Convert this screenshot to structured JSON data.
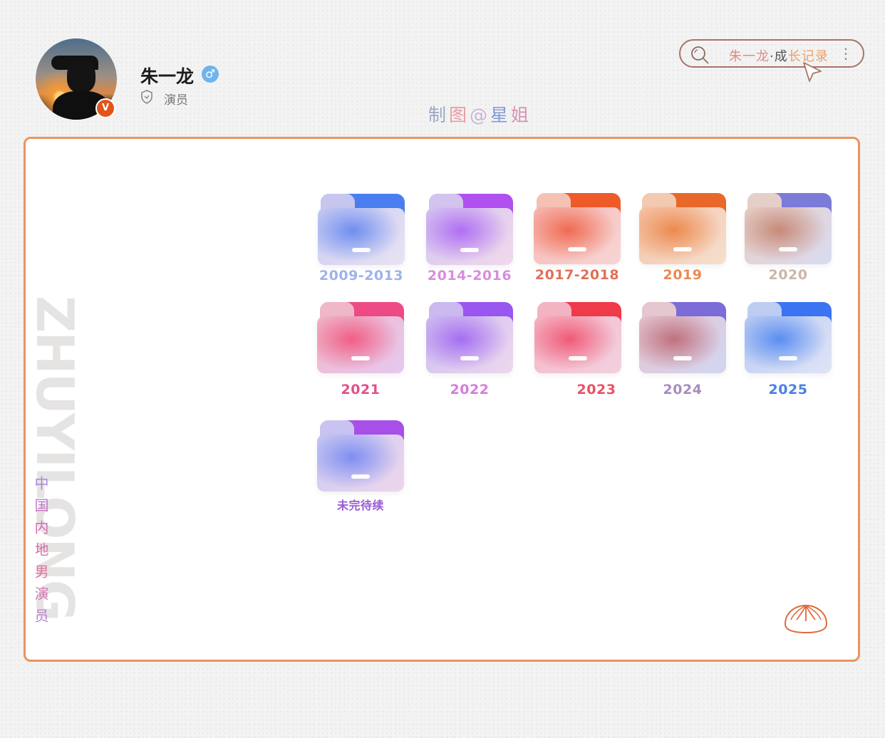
{
  "profile": {
    "name": "朱一龙",
    "role": "演员",
    "verified_badge": "V",
    "gender_symbol": "♂"
  },
  "credit": [
    "制",
    "图",
    "@",
    "星",
    "姐"
  ],
  "search": {
    "text_parts": [
      "朱一龙",
      "·",
      "成",
      "长记录"
    ],
    "more_symbol": "⋮"
  },
  "watermark": "ZHUYILONG",
  "vertical_caption": "中国内地男演员",
  "folders": [
    {
      "label": "2009-2013",
      "label_color": "#9fb2ea",
      "tab_color": "#4a7ef0",
      "tab_front": "#c6c6ee",
      "pocket_from": "#c9cbf2",
      "pocket_glow": "#6f8ef0",
      "pocket_to": "#e9e3f2"
    },
    {
      "label": "2014-2016",
      "label_color": "#d98ddc",
      "tab_color": "#b050f0",
      "tab_front": "#d2c3ef",
      "pocket_from": "#d3c6f2",
      "pocket_glow": "#b06ef2",
      "pocket_to": "#f1d9ea"
    },
    {
      "label": "2017-2018",
      "label_color": "#e07156",
      "tab_color": "#ef5a2a",
      "tab_front": "#f6c1b5",
      "pocket_from": "#f7b9b2",
      "pocket_glow": "#f06a52",
      "pocket_to": "#f6d6d6"
    },
    {
      "label": "2019",
      "label_color": "#ea8a53",
      "tab_color": "#e8682a",
      "tab_front": "#f3c9b0",
      "pocket_from": "#f5c3a8",
      "pocket_glow": "#ec8a4e",
      "pocket_to": "#f5dfcf"
    },
    {
      "label": "2020",
      "label_color": "#cdb5a5",
      "tab_color": "#7c7bd8",
      "tab_front": "#e7cfc9",
      "pocket_from": "#e8cfc6",
      "pocket_glow": "#c78a78",
      "pocket_to": "#d9dbf2"
    },
    {
      "label": "2021",
      "label_color": "#e0508a",
      "tab_color": "#ee4a86",
      "tab_front": "#efb8c8",
      "pocket_from": "#f0b8c8",
      "pocket_glow": "#f05e86",
      "pocket_to": "#e6c8f0"
    },
    {
      "label": "2022",
      "label_color": "#d57ce0",
      "tab_color": "#9a56f0",
      "tab_front": "#cbb9ef",
      "pocket_from": "#cdbdf0",
      "pocket_glow": "#a56ef2",
      "pocket_to": "#edd8ee"
    },
    {
      "label": "2023",
      "label_color": "#ea5068",
      "tab_color": "#ef3a4a",
      "tab_front": "#f4b3c3",
      "pocket_from": "#f5b6c6",
      "pocket_glow": "#f05a78",
      "pocket_to": "#f2d1e0"
    },
    {
      "label": "2024",
      "label_color": "#a68dc0",
      "tab_color": "#7c6cd8",
      "tab_front": "#e4c7cf",
      "pocket_from": "#e6c5cf",
      "pocket_glow": "#c0707e",
      "pocket_to": "#d2d6f2"
    },
    {
      "label": "2025",
      "label_color": "#4a7fe6",
      "tab_color": "#3b74f2",
      "tab_front": "#bdcdf2",
      "pocket_from": "#bccbf2",
      "pocket_glow": "#5a8ef2",
      "pocket_to": "#dfe4f6"
    },
    {
      "label": "未完待续",
      "label_color": "#9a58d8",
      "tab_color": "#a74fe8",
      "tab_front": "#c8c3f0",
      "pocket_from": "#c9c9f2",
      "pocket_glow": "#7e8ef2",
      "pocket_to": "#efd6ec"
    }
  ],
  "colors": {
    "frame_border": "#e8955f",
    "search_border": "#a87467",
    "bun_stroke": "#e06a3a"
  },
  "icons": [
    "search-icon",
    "cursor-icon",
    "kebab-icon",
    "shield-icon",
    "gender-male-icon",
    "verified-icon",
    "steamed-bun-icon",
    "folder-icon"
  ]
}
